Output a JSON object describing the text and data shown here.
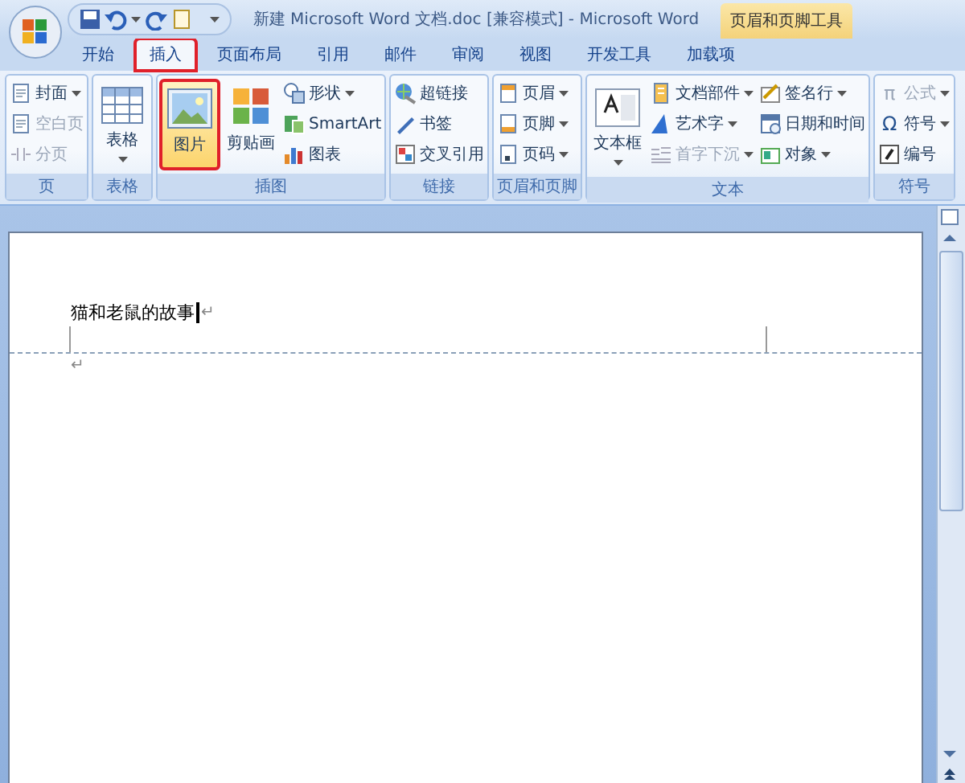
{
  "window": {
    "title": "新建 Microsoft Word 文档.doc [兼容模式] - Microsoft Word",
    "context_tab": "页眉和页脚工具"
  },
  "tabs": [
    {
      "label": "开始",
      "selected": false,
      "highlighted": false
    },
    {
      "label": "插入",
      "selected": true,
      "highlighted": true
    },
    {
      "label": "页面布局",
      "selected": false,
      "highlighted": false
    },
    {
      "label": "引用",
      "selected": false,
      "highlighted": false
    },
    {
      "label": "邮件",
      "selected": false,
      "highlighted": false
    },
    {
      "label": "审阅",
      "selected": false,
      "highlighted": false
    },
    {
      "label": "视图",
      "selected": false,
      "highlighted": false
    },
    {
      "label": "开发工具",
      "selected": false,
      "highlighted": false
    },
    {
      "label": "加载项",
      "selected": false,
      "highlighted": false
    }
  ],
  "ribbon": {
    "groups": [
      {
        "label": "页",
        "items": [
          {
            "kind": "column",
            "items": [
              {
                "label": "封面",
                "dropdown": true,
                "disabled": false
              },
              {
                "label": "空白页",
                "dropdown": false,
                "disabled": true
              },
              {
                "label": "分页",
                "dropdown": false,
                "disabled": true
              }
            ]
          }
        ]
      },
      {
        "label": "表格",
        "items": [
          {
            "kind": "large",
            "label": "表格",
            "dropdown": true,
            "highlighted": false
          }
        ]
      },
      {
        "label": "插图",
        "items": [
          {
            "kind": "large",
            "label": "图片",
            "dropdown": false,
            "highlighted": true
          },
          {
            "kind": "large",
            "label": "剪贴画",
            "dropdown": false,
            "highlighted": false
          },
          {
            "kind": "column",
            "items": [
              {
                "label": "形状",
                "dropdown": true,
                "disabled": false
              },
              {
                "label": "SmartArt",
                "dropdown": false,
                "disabled": false
              },
              {
                "label": "图表",
                "dropdown": false,
                "disabled": false
              }
            ]
          }
        ]
      },
      {
        "label": "链接",
        "items": [
          {
            "kind": "column",
            "items": [
              {
                "label": "超链接",
                "dropdown": false,
                "disabled": false
              },
              {
                "label": "书签",
                "dropdown": false,
                "disabled": false
              },
              {
                "label": "交叉引用",
                "dropdown": false,
                "disabled": false
              }
            ]
          }
        ]
      },
      {
        "label": "页眉和页脚",
        "items": [
          {
            "kind": "column",
            "items": [
              {
                "label": "页眉",
                "dropdown": true,
                "disabled": false
              },
              {
                "label": "页脚",
                "dropdown": true,
                "disabled": false
              },
              {
                "label": "页码",
                "dropdown": true,
                "disabled": false
              }
            ]
          }
        ]
      },
      {
        "label": "文本",
        "items": [
          {
            "kind": "large",
            "label": "文本框",
            "dropdown": true,
            "highlighted": false
          },
          {
            "kind": "column",
            "items": [
              {
                "label": "文档部件",
                "dropdown": true,
                "disabled": false
              },
              {
                "label": "艺术字",
                "dropdown": true,
                "disabled": false
              },
              {
                "label": "首字下沉",
                "dropdown": true,
                "disabled": true
              }
            ]
          },
          {
            "kind": "column",
            "items": [
              {
                "label": "签名行",
                "dropdown": true,
                "disabled": false
              },
              {
                "label": "日期和时间",
                "dropdown": false,
                "disabled": false
              },
              {
                "label": "对象",
                "dropdown": true,
                "disabled": false
              }
            ]
          }
        ]
      },
      {
        "label": "符号",
        "items": [
          {
            "kind": "column",
            "items": [
              {
                "label": "公式",
                "glyph": "π",
                "dropdown": true,
                "disabled": true
              },
              {
                "label": "符号",
                "glyph": "Ω",
                "dropdown": true,
                "disabled": false
              },
              {
                "label": "编号",
                "dropdown": false,
                "disabled": false
              }
            ]
          }
        ]
      }
    ]
  },
  "document": {
    "header": {
      "text": "猫和老鼠的故事",
      "cursor": true,
      "mark": "↵"
    },
    "body": [
      {
        "mark": "↵"
      }
    ]
  }
}
